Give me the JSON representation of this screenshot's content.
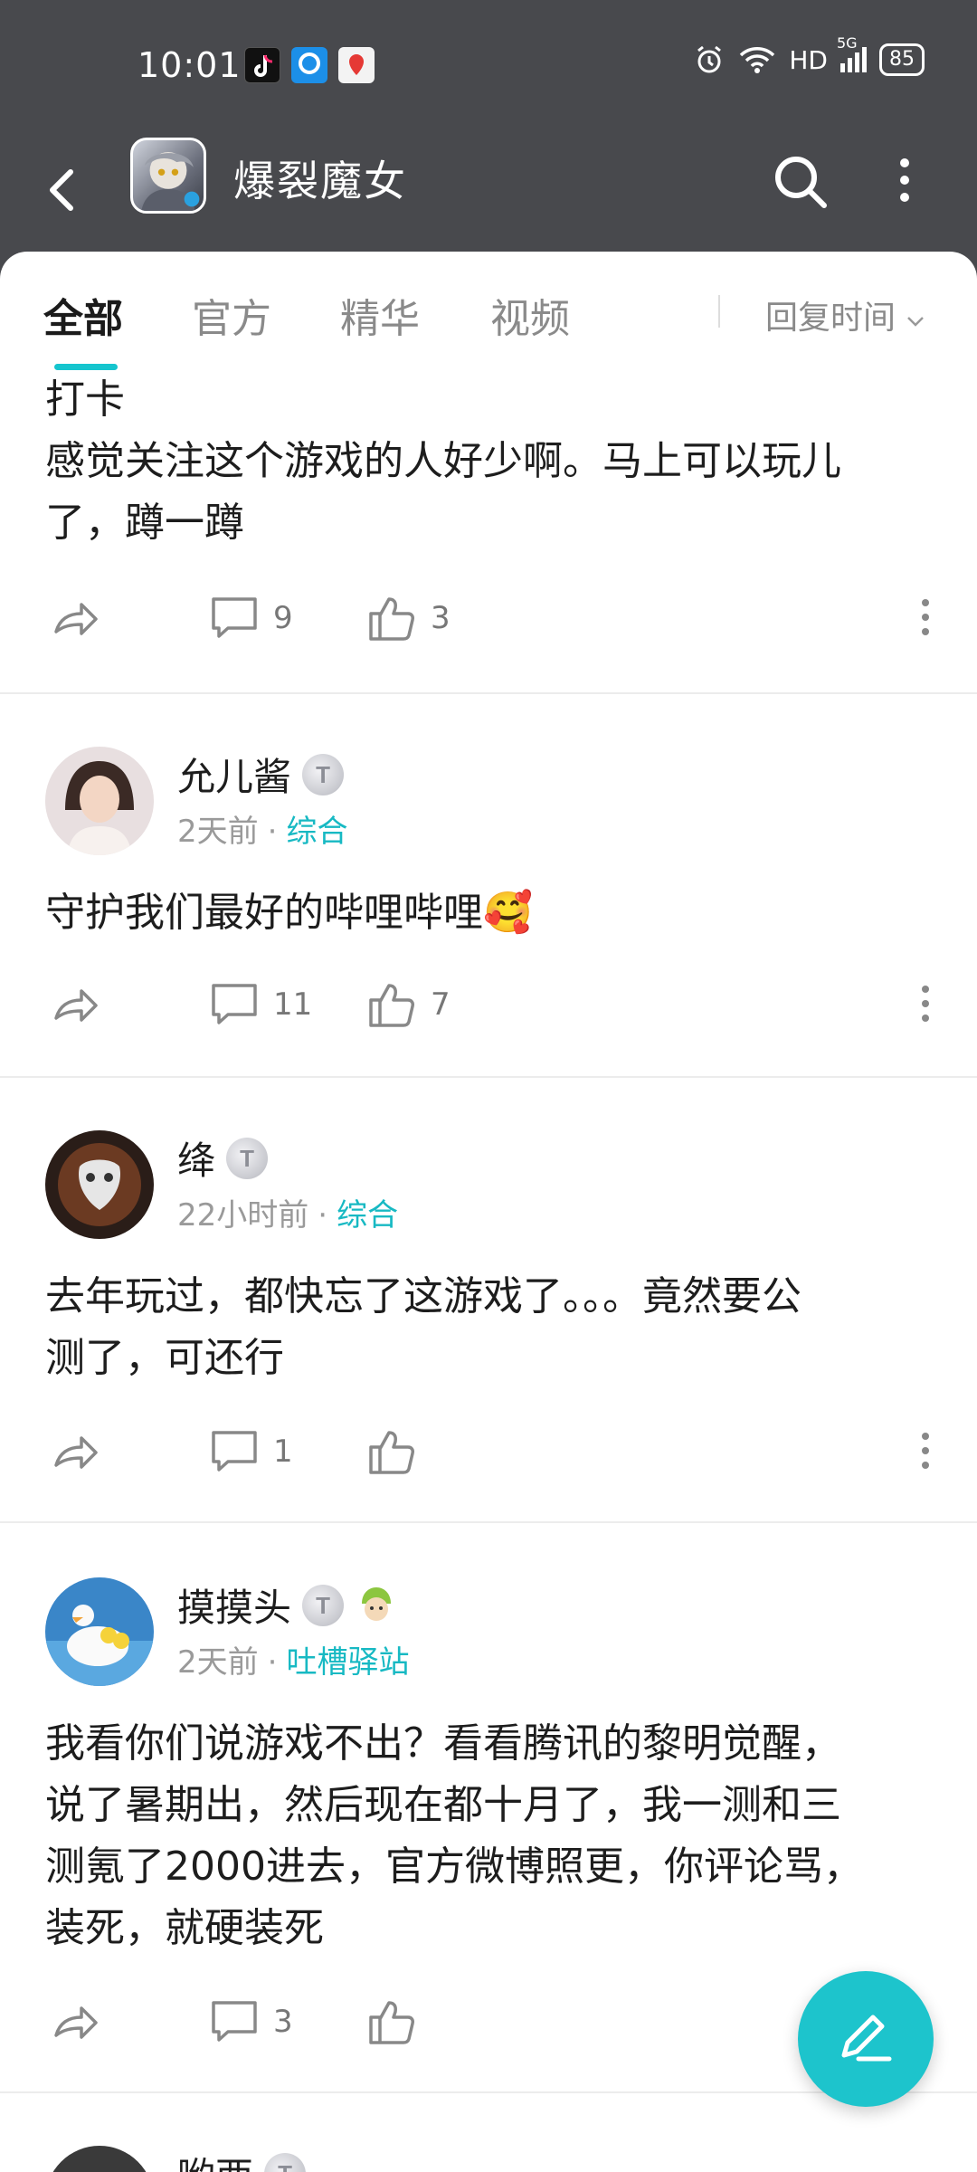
{
  "status_bar": {
    "time": "10:01",
    "network": "HD",
    "cell": "5G",
    "battery": "85"
  },
  "app_bar": {
    "title": "爆裂魔女"
  },
  "tabs": [
    {
      "label": "全部",
      "active": true
    },
    {
      "label": "官方",
      "active": false
    },
    {
      "label": "精华",
      "active": false
    },
    {
      "label": "视频",
      "active": false
    }
  ],
  "sort": {
    "label": "回复时间"
  },
  "posts": [
    {
      "text_lines": [
        "打卡",
        "感觉关注这个游戏的人好少啊。马上可以玩儿",
        "了，蹲一蹲"
      ],
      "comments": "9",
      "likes": "3"
    },
    {
      "author": "允儿酱",
      "level": "T",
      "time": "2天前",
      "category": "综合",
      "text_lines": [
        "守护我们最好的哔哩哔哩🥰"
      ],
      "comments": "11",
      "likes": "7"
    },
    {
      "author": "绛",
      "level": "T",
      "time": "22小时前",
      "category": "综合",
      "text_lines": [
        "去年玩过，都快忘了这游戏了。。。竟然要公",
        "测了，可还行"
      ],
      "comments": "1",
      "likes": ""
    },
    {
      "author": "摸摸头",
      "level": "T",
      "time": "2天前",
      "category": "吐槽驿站",
      "text_lines": [
        "我看你们说游戏不出？看看腾讯的黎明觉醒，",
        "说了暑期出，然后现在都十月了，我一测和三",
        "测氪了2000进去，官方微博照更，你评论骂，",
        "装死，就硬装死"
      ],
      "comments": "3",
      "likes": ""
    },
    {
      "author": "哟西",
      "level": "T"
    }
  ],
  "colors": {
    "accent": "#1dc4cc",
    "header": "#48494d"
  }
}
